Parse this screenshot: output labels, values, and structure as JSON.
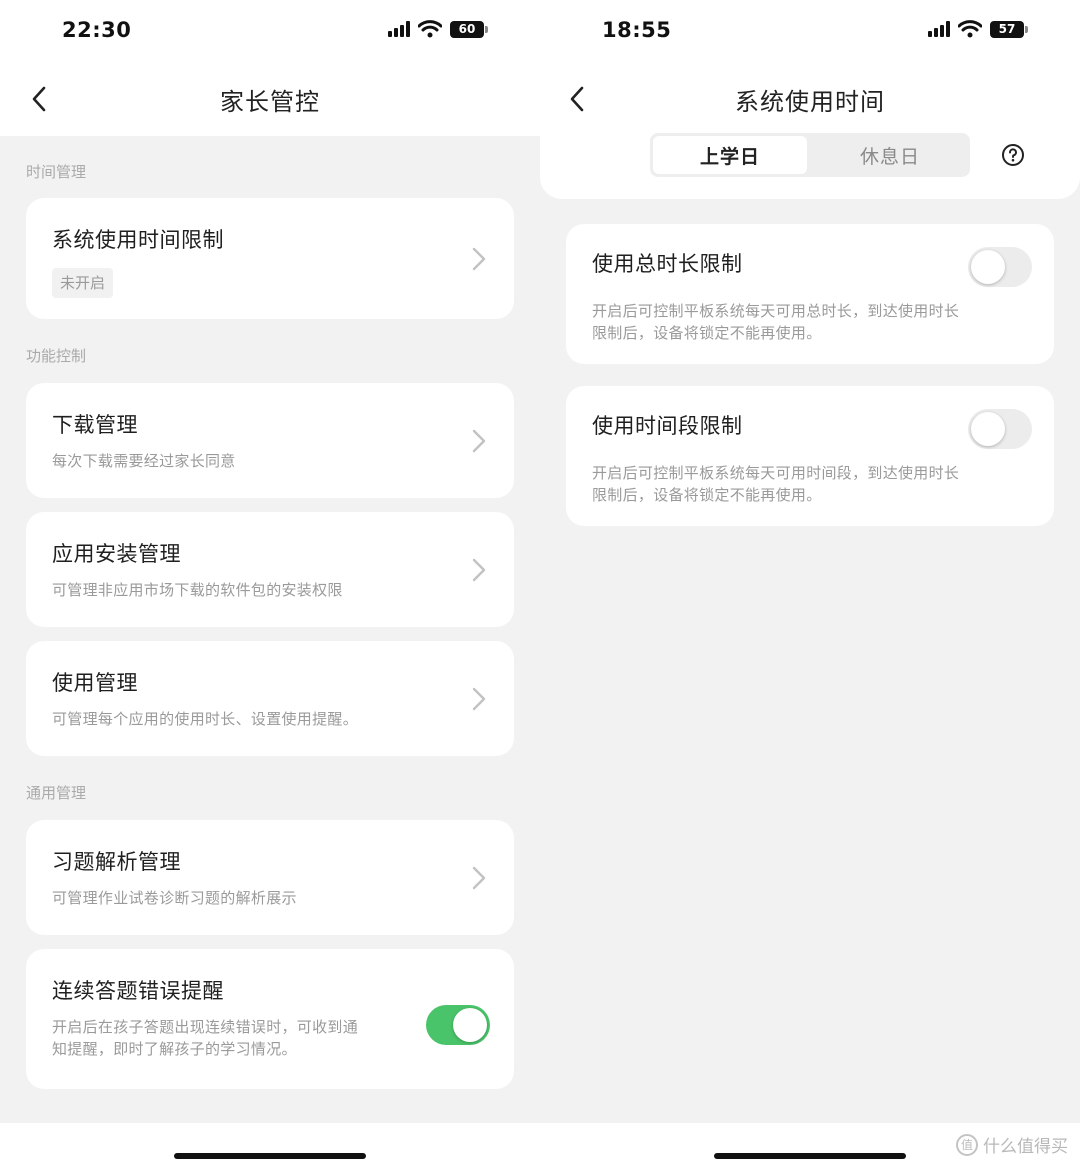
{
  "left": {
    "status": {
      "time": "22:30",
      "battery": "60"
    },
    "nav": {
      "title": "家长管控"
    },
    "sections": {
      "time": "时间管理",
      "function": "功能控制",
      "general": "通用管理"
    },
    "screen_time": {
      "title": "系统使用时间限制",
      "status": "未开启"
    },
    "download": {
      "title": "下载管理",
      "desc": "每次下载需要经过家长同意"
    },
    "install": {
      "title": "应用安装管理",
      "desc": "可管理非应用市场下载的软件包的安装权限"
    },
    "usage": {
      "title": "使用管理",
      "desc": "可管理每个应用的使用时长、设置使用提醒。"
    },
    "exercise": {
      "title": "习题解析管理",
      "desc": "可管理作业试卷诊断习题的解析展示"
    },
    "error_alert": {
      "title": "连续答题错误提醒",
      "desc_line1": "开启后在孩子答题出现连续错误时，可收到通",
      "desc_line2": "知提醒，即时了解孩子的学习情况。",
      "enabled": true
    }
  },
  "right": {
    "status": {
      "time": "18:55",
      "battery": "57"
    },
    "nav": {
      "title": "系统使用时间"
    },
    "tabs": {
      "school_day": "上学日",
      "rest_day": "休息日",
      "selected": "上学日"
    },
    "total_limit": {
      "title": "使用总时长限制",
      "desc_line1": "开启后可控制平板系统每天可用总时长，到达使用时长",
      "desc_line2": "限制后，设备将锁定不能再使用。",
      "enabled": false
    },
    "period_limit": {
      "title": "使用时间段限制",
      "desc_line1": "开启后可控制平板系统每天可用时间段，到达使用时长",
      "desc_line2": "限制后，设备将锁定不能再使用。",
      "enabled": false
    }
  },
  "watermark": {
    "text": "什么值得买"
  },
  "colors": {
    "toggle_on": "#4ac46a",
    "toggle_off": "#ececec",
    "background": "#f2f2f2"
  },
  "icons": [
    "back-arrow-icon",
    "chevron-right-icon",
    "help-circle-icon",
    "signal-icon",
    "wifi-icon",
    "battery-icon"
  ]
}
